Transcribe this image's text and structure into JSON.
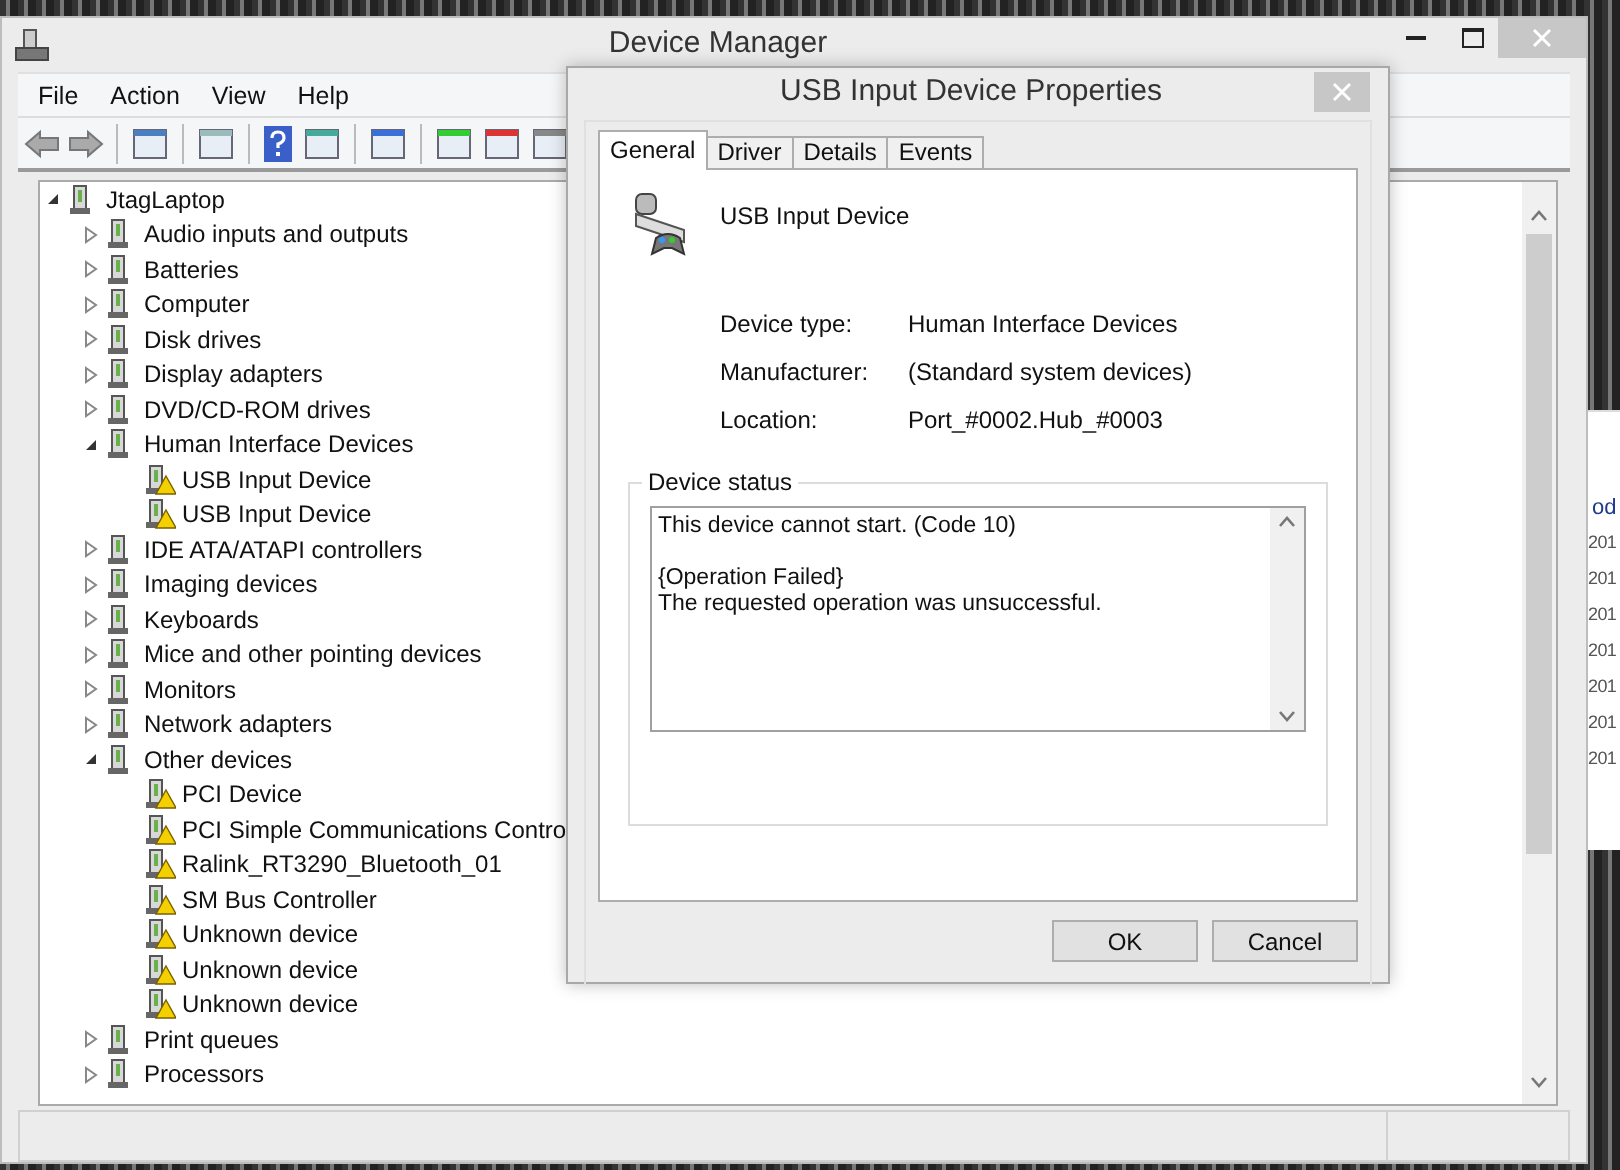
{
  "window": {
    "title": "Device Manager"
  },
  "menu": [
    "File",
    "Action",
    "View",
    "Help"
  ],
  "tree": {
    "label": "JtagLaptop",
    "expanded": true,
    "children": [
      {
        "label": "Audio inputs and outputs",
        "expanded": false
      },
      {
        "label": "Batteries",
        "expanded": false
      },
      {
        "label": "Computer",
        "expanded": false
      },
      {
        "label": "Disk drives",
        "expanded": false
      },
      {
        "label": "Display adapters",
        "expanded": false
      },
      {
        "label": "DVD/CD-ROM drives",
        "expanded": false
      },
      {
        "label": "Human Interface Devices",
        "expanded": true,
        "children": [
          {
            "label": "USB Input Device",
            "warning": true
          },
          {
            "label": "USB Input Device",
            "warning": true
          }
        ]
      },
      {
        "label": "IDE ATA/ATAPI controllers",
        "expanded": false
      },
      {
        "label": "Imaging devices",
        "expanded": false
      },
      {
        "label": "Keyboards",
        "expanded": false
      },
      {
        "label": "Mice and other pointing devices",
        "expanded": false
      },
      {
        "label": "Monitors",
        "expanded": false
      },
      {
        "label": "Network adapters",
        "expanded": false
      },
      {
        "label": "Other devices",
        "expanded": true,
        "children": [
          {
            "label": "PCI Device",
            "warning": true
          },
          {
            "label": "PCI Simple Communications Contro",
            "warning": true
          },
          {
            "label": "Ralink_RT3290_Bluetooth_01",
            "warning": true
          },
          {
            "label": "SM Bus Controller",
            "warning": true
          },
          {
            "label": "Unknown device",
            "warning": true
          },
          {
            "label": "Unknown device",
            "warning": true
          },
          {
            "label": "Unknown device",
            "warning": true
          }
        ]
      },
      {
        "label": "Print queues",
        "expanded": false
      },
      {
        "label": "Processors",
        "expanded": false
      }
    ]
  },
  "background_window": {
    "header": "od",
    "cells": [
      "201",
      "201",
      "201",
      "201",
      "201",
      "201",
      "201"
    ]
  },
  "dialog": {
    "title": "USB Input Device Properties",
    "tabs": [
      {
        "label": "General",
        "selected": true
      },
      {
        "label": "Driver",
        "selected": false
      },
      {
        "label": "Details",
        "selected": false
      },
      {
        "label": "Events",
        "selected": false
      }
    ],
    "device_name": "USB Input Device",
    "properties": [
      {
        "label": "Device type:",
        "value": "Human Interface Devices"
      },
      {
        "label": "Manufacturer:",
        "value": "(Standard system devices)"
      },
      {
        "label": "Location:",
        "value": "Port_#0002.Hub_#0003"
      }
    ],
    "status_group": "Device status",
    "status_paragraphs": [
      [
        "This device cannot start. (Code 10)"
      ],
      [
        "{Operation Failed}",
        "The requested operation was unsuccessful."
      ]
    ],
    "buttons": [
      "OK",
      "Cancel"
    ]
  }
}
